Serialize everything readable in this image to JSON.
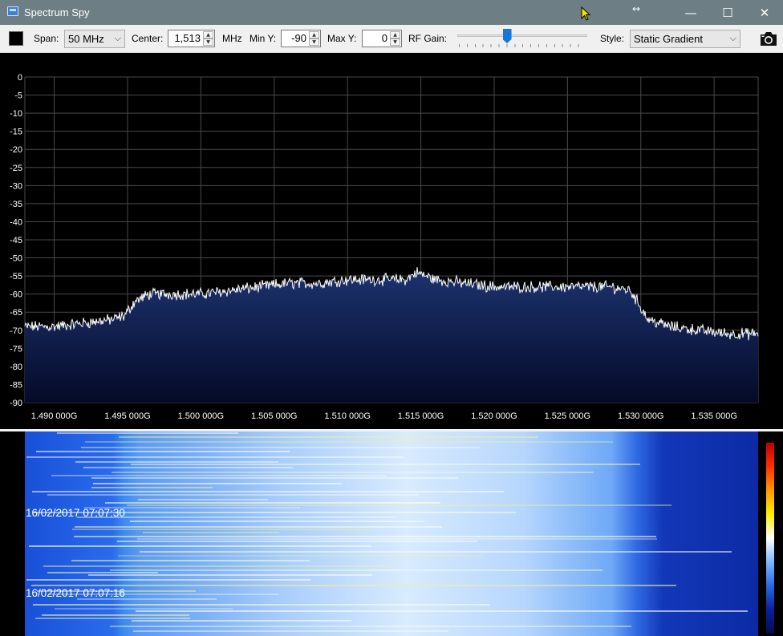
{
  "window": {
    "title": "Spectrum Spy",
    "minimize_glyph": "—",
    "maximize_glyph": "☐",
    "close_glyph": "✕",
    "resize_glyph": "↔"
  },
  "toolbar": {
    "trace_color": "#000000",
    "span_label": "Span:",
    "span_value": "50 MHz",
    "center_label": "Center:",
    "center_value": "1,513",
    "center_unit": "MHz",
    "min_y_label": "Min Y:",
    "min_y_value": "-90",
    "max_y_label": "Max Y:",
    "max_y_value": "0",
    "rf_gain_label": "RF Gain:",
    "rf_gain_level": 0.38,
    "style_label": "Style:",
    "style_value": "Static Gradient",
    "camera_icon": "camera-icon"
  },
  "chart_data": {
    "type": "area",
    "xlabel": "",
    "ylabel": "",
    "ylim": [
      -90,
      0
    ],
    "xlim": [
      1.488,
      1.538
    ],
    "x_unit": "GHz",
    "yticks": [
      0,
      -5,
      -10,
      -15,
      -20,
      -25,
      -30,
      -35,
      -40,
      -45,
      -50,
      -55,
      -60,
      -65,
      -70,
      -75,
      -80,
      -85,
      -90
    ],
    "xticks": [
      "1.490 000G",
      "1.495 000G",
      "1.500 000G",
      "1.505 000G",
      "1.510 000G",
      "1.515 000G",
      "1.520 000G",
      "1.525 000G",
      "1.530 000G",
      "1.535 000G"
    ],
    "xtick_values": [
      1.49,
      1.495,
      1.5,
      1.505,
      1.51,
      1.515,
      1.52,
      1.525,
      1.53,
      1.535
    ],
    "grid": true,
    "series": [
      {
        "x": [
          1.488,
          1.49,
          1.492,
          1.494,
          1.4948,
          1.4955,
          1.4965,
          1.498,
          1.5,
          1.502,
          1.504,
          1.506,
          1.508,
          1.51,
          1.512,
          1.514,
          1.5147,
          1.516,
          1.518,
          1.52,
          1.522,
          1.524,
          1.526,
          1.528,
          1.5293,
          1.5305,
          1.532,
          1.534,
          1.536,
          1.538
        ],
        "y": [
          -69,
          -69,
          -68,
          -67,
          -66,
          -62,
          -60,
          -60,
          -60,
          -59,
          -58,
          -57,
          -57,
          -56,
          -56,
          -56,
          -54,
          -56,
          -57,
          -58,
          -58,
          -58,
          -58,
          -58,
          -59,
          -67,
          -69,
          -70,
          -71,
          -71
        ]
      }
    ],
    "line_color": "#ffffff",
    "fill_top_color": "#1c3470",
    "fill_bottom_color": "#050a28"
  },
  "waterfall": {
    "timestamps": [
      "16/02/2017 07:07:30",
      "16/02/2017 07:07:16"
    ],
    "colorbar_colors": [
      "#c00000",
      "#ff3000",
      "#ff9a00",
      "#ffee00",
      "#ffffff",
      "#7fb6ff",
      "#2a68e0",
      "#0a1f9a",
      "#040c50"
    ]
  }
}
